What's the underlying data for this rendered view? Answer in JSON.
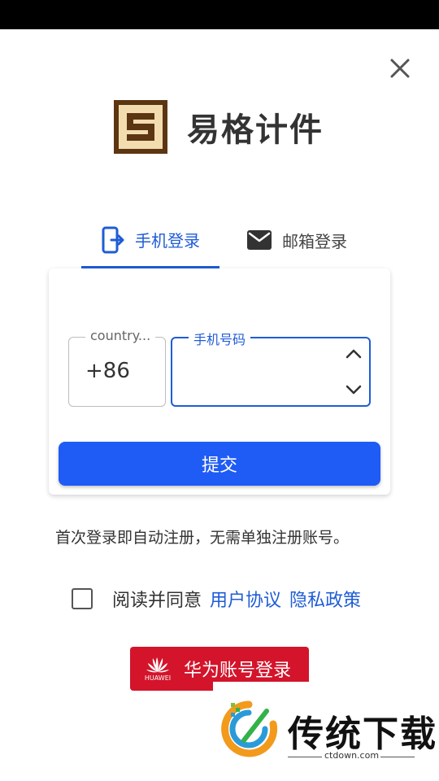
{
  "app": {
    "name": "易格计件"
  },
  "tabs": [
    {
      "label": "手机登录",
      "icon": "phone-login-icon",
      "active": true
    },
    {
      "label": "邮箱登录",
      "icon": "mail-icon",
      "active": false
    }
  ],
  "form": {
    "country_label": "country...",
    "country_code": "+86",
    "phone_label": "手机号码",
    "phone_value": "",
    "submit_label": "提交"
  },
  "hint": "首次登录即自动注册，无需单独注册账号。",
  "agreement": {
    "checked": false,
    "text": "阅读并同意",
    "user_agreement": "用户协议",
    "privacy_policy": "隐私政策"
  },
  "huawei": {
    "logo_text": "HUAWEI",
    "label": "华为账号登录"
  },
  "watermark": {
    "title": "传统下载",
    "subtitle": "ctdown.com"
  },
  "colors": {
    "accent": "#1f5cd6",
    "submit": "#1f5bf5",
    "huawei": "#d3142b"
  }
}
